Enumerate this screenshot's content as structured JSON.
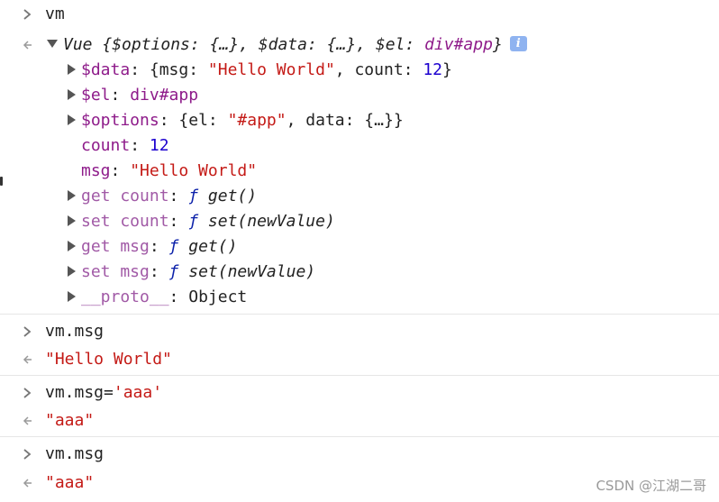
{
  "entries": [
    {
      "input": "vm"
    },
    {
      "output_header": {
        "class_name": "Vue",
        "open": " {",
        "k1": "$options",
        "v1": "{…}",
        "k2": "$data",
        "v2": "{…}",
        "k3": "$el",
        "v3": "div#app",
        "close": "}",
        "info_glyph": "i"
      },
      "props": {
        "data_key": "$data",
        "data_open": "{msg: ",
        "data_msg": "\"Hello World\"",
        "data_mid": ", count: ",
        "data_count": "12",
        "data_close": "}",
        "el_key": "$el",
        "el_val": "div#app",
        "options_key": "$options",
        "options_open": "{el: ",
        "options_el": "\"#app\"",
        "options_rest": ", data: {…}}",
        "count_key": "count",
        "count_val": "12",
        "msg_key": "msg",
        "msg_val": "\"Hello World\"",
        "get_count_key": "get count",
        "get_count_f": "ƒ",
        "get_count_sig": "get()",
        "set_count_key": "set count",
        "set_count_f": "ƒ",
        "set_count_sig": "set(newValue)",
        "get_msg_key": "get msg",
        "get_msg_f": "ƒ",
        "get_msg_sig": "get()",
        "set_msg_key": "set msg",
        "set_msg_f": "ƒ",
        "set_msg_sig": "set(newValue)",
        "proto_key": "__proto__",
        "proto_val": "Object"
      }
    },
    {
      "input": "vm.msg",
      "output": "\"Hello World\""
    },
    {
      "input_prefix": "vm.msg=",
      "input_str": "'aaa'",
      "output": "\"aaa\""
    },
    {
      "input": "vm.msg",
      "output": "\"aaa\""
    }
  ],
  "colon": ": ",
  "watermark": "CSDN @江湖二哥",
  "colors": {
    "key_purple": "#8e1b8a",
    "string_red": "#c41a16",
    "number_blue": "#1c00cf",
    "function_blue": "#0d22aa",
    "info_badge": "#8fb3f0"
  }
}
